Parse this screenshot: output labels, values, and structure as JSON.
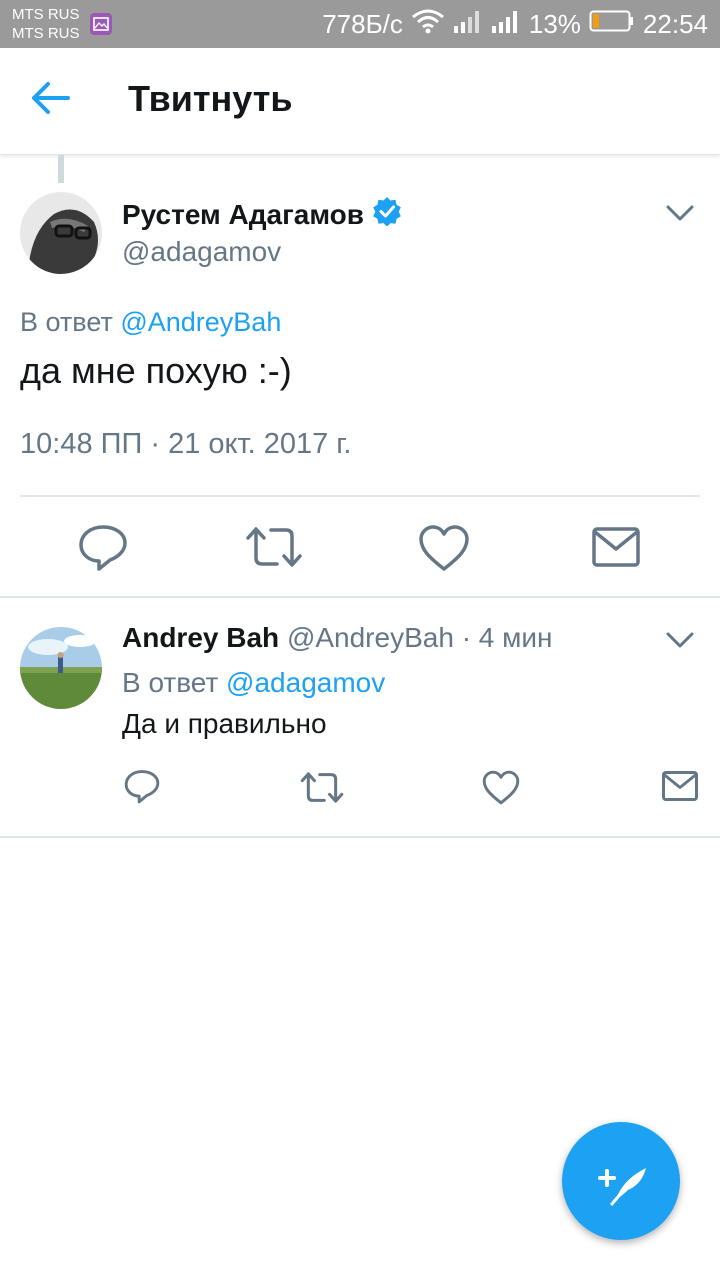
{
  "status_bar": {
    "carrier1": "MTS RUS",
    "carrier2": "MTS RUS",
    "speed": "778Б/с",
    "battery": "13%",
    "time": "22:54"
  },
  "app_bar": {
    "title": "Твитнуть"
  },
  "main_tweet": {
    "author_name": "Рустем Адагамов",
    "handle": "@adagamov",
    "reply_prefix": "В ответ",
    "reply_to": "@AndreyBah",
    "text": "да мне похую :-)",
    "timestamp": "10:48 ПП · 21 окт. 2017 г."
  },
  "reply_tweet": {
    "author_name": "Andrey Bah",
    "handle": "@AndreyBah",
    "time_ago": "· 4 мин",
    "reply_prefix": "В ответ",
    "reply_to": "@adagamov",
    "text": "Да и правильно"
  },
  "colors": {
    "accent": "#1da1f2",
    "secondary_text": "#657786",
    "primary_text": "#14171a"
  }
}
